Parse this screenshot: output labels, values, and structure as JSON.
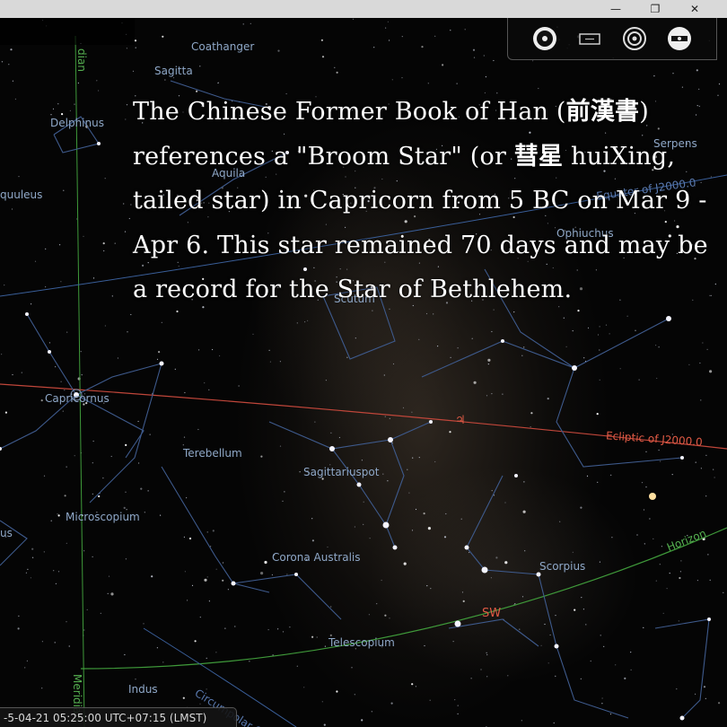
{
  "window": {
    "minimize": "—",
    "maximize": "❐",
    "close": "✕"
  },
  "toolbar": {
    "buttons": [
      "night-mode-icon",
      "window-mode-icon",
      "target-icon",
      "quit-icon"
    ]
  },
  "labels": {
    "constellations": {
      "coathanger": "Coathanger",
      "sagitta": "Sagitta",
      "delphinus": "Delphinus",
      "aquila": "Aquila",
      "equuleus": "quuleus",
      "serpens": "Serpens",
      "ophiuchus": "Ophiuchus",
      "scutum": "Scutum",
      "capricornus": "Capricornus",
      "terebellum": "Terebellum",
      "sagittarius_teapot": "Sagittariuspot",
      "microscopium": "Microscopium",
      "corona_australis": "Corona Australis",
      "scorpius": "Scorpius",
      "telescopium": "Telescopium",
      "indus": "Indus",
      "piscis_partial": "us"
    },
    "grid": {
      "equator": "Equator of J2000.0",
      "ecliptic": "Ecliptic of J2000.0",
      "horizon": "Horizon",
      "meridian": "Meridian",
      "meridian_top": "dian",
      "circumpolar": "Circumpolar Circle"
    },
    "cardinal": "SW",
    "planet_symbol": "♃"
  },
  "caption": {
    "line1_a": "The Chinese Former Book of Han (",
    "line1_cjk": "前漢書",
    "line1_b": ")",
    "line2_a": "references a \"Broom Star\" (or ",
    "line2_cjk": "彗星",
    "line2_b": " huiXing,",
    "line3": "tailed star) in Capricorn from 5 BC on Mar 9 -",
    "line4": "Apr 6. This star remained 70 days and may be",
    "line5": "a record for the Star of Bethlehem."
  },
  "status": {
    "datetime": "-5-04-21 05:25:00 UTC+07:15 (LMST)"
  },
  "colors": {
    "constellation_line": "#3e5a8c",
    "constellation_label": "#8fa8c8",
    "ecliptic": "#c0463a",
    "equator": "#3a5f9a",
    "horizon": "#3f9a3a",
    "meridian": "#3f9a3a",
    "cardinal": "#e05a45"
  }
}
